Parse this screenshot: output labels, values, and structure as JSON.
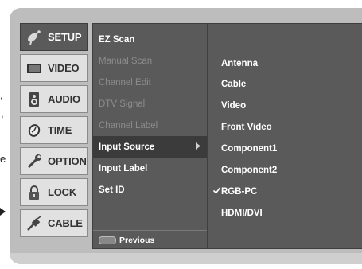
{
  "categories": [
    {
      "label": "SETUP",
      "icon": "satellite-dish-icon",
      "active": true
    },
    {
      "label": "VIDEO",
      "icon": "tv-screen-icon",
      "active": false
    },
    {
      "label": "AUDIO",
      "icon": "speaker-icon",
      "active": false
    },
    {
      "label": "TIME",
      "icon": "clock-icon",
      "active": false
    },
    {
      "label": "OPTION",
      "icon": "wrench-icon",
      "active": false
    },
    {
      "label": "LOCK",
      "icon": "padlock-icon",
      "active": false
    },
    {
      "label": "CABLE",
      "icon": "cable-plug-icon",
      "active": false
    }
  ],
  "setup_menu": {
    "items": [
      {
        "label": "EZ Scan",
        "state": "enabled"
      },
      {
        "label": "Manual Scan",
        "state": "disabled"
      },
      {
        "label": "Channel Edit",
        "state": "disabled"
      },
      {
        "label": "DTV Signal",
        "state": "disabled"
      },
      {
        "label": "Channel Label",
        "state": "disabled"
      },
      {
        "label": "Input Source",
        "state": "selected"
      },
      {
        "label": "Input Label",
        "state": "enabled"
      },
      {
        "label": "Set ID",
        "state": "enabled"
      }
    ],
    "previous_key": "MENU",
    "previous_label": "Previous"
  },
  "input_options": {
    "items": [
      "Antenna",
      "Cable",
      "Video",
      "Front Video",
      "Component1",
      "Component2",
      "RGB-PC",
      "HDMI/DVI"
    ],
    "checked": "RGB-PC"
  },
  "page_edge_text": [
    ",",
    ",",
    "e"
  ],
  "colors": {
    "panel": "#5a5a5a",
    "selected_row": "#3b3b3b",
    "frame": "#bdbdbd",
    "category_bg": "#e1e1e1",
    "disabled_text": "#8c8c8c"
  }
}
